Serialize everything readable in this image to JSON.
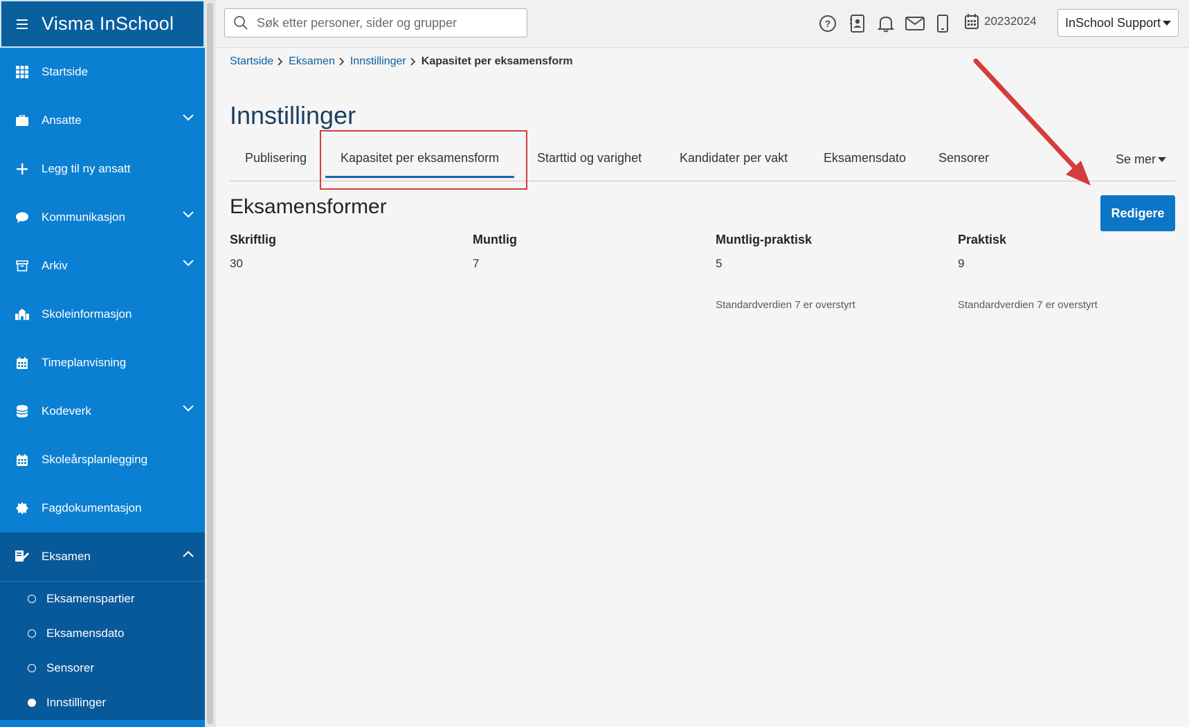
{
  "app": {
    "title": "Visma InSchool"
  },
  "sidebar": {
    "items": [
      {
        "label": "Startside",
        "icon": "grid-icon"
      },
      {
        "label": "Ansatte",
        "icon": "briefcase-icon"
      },
      {
        "label": "Legg til ny ansatt",
        "icon": "plus-icon"
      },
      {
        "label": "Kommunikasjon",
        "icon": "chat-bubble-icon"
      },
      {
        "label": "Arkiv",
        "icon": "archive-box-icon"
      },
      {
        "label": "Skoleinformasjon",
        "icon": "school-icon"
      },
      {
        "label": "Timeplanvisning",
        "icon": "calendar-icon"
      },
      {
        "label": "Kodeverk",
        "icon": "database-icon"
      },
      {
        "label": "Skoleårsplanlegging",
        "icon": "calendar-icon"
      },
      {
        "label": "Fagdokumentasjon",
        "icon": "badge-icon"
      },
      {
        "label": "Eksamen",
        "icon": "exam-edit-icon"
      }
    ],
    "submenu": [
      {
        "label": "Eksamenspartier"
      },
      {
        "label": "Eksamensdato"
      },
      {
        "label": "Sensorer"
      },
      {
        "label": "Innstillinger"
      }
    ]
  },
  "topbar": {
    "search_placeholder": "Søk etter personer, sider og grupper",
    "school_year": "20232024",
    "user_menu_label": "InSchool Support"
  },
  "breadcrumb": {
    "items": [
      "Startside",
      "Eksamen",
      "Innstillinger"
    ],
    "current": "Kapasitet per eksamensform"
  },
  "page": {
    "title": "Innstillinger",
    "tabs": [
      "Publisering",
      "Kapasitet per eksamensform",
      "Starttid og varighet",
      "Kandidater per vakt",
      "Eksamensdato",
      "Sensorer"
    ],
    "active_tab": "Kapasitet per eksamensform",
    "more_label": "Se mer",
    "section_title": "Eksamensformer",
    "edit_button_label": "Redigere",
    "forms": [
      {
        "label": "Skriftlig",
        "value": "30",
        "note": ""
      },
      {
        "label": "Muntlig",
        "value": "7",
        "note": ""
      },
      {
        "label": "Muntlig-praktisk",
        "value": "5",
        "note": "Standardverdien 7 er overstyrt"
      },
      {
        "label": "Praktisk",
        "value": "9",
        "note": "Standardverdien 7 er overstyrt"
      }
    ]
  },
  "colors": {
    "sidebar_bg": "#0b7fd1",
    "sidebar_active_bg": "#08599a",
    "primary_button": "#0b76c6",
    "annotation_red": "#d53d3d"
  }
}
